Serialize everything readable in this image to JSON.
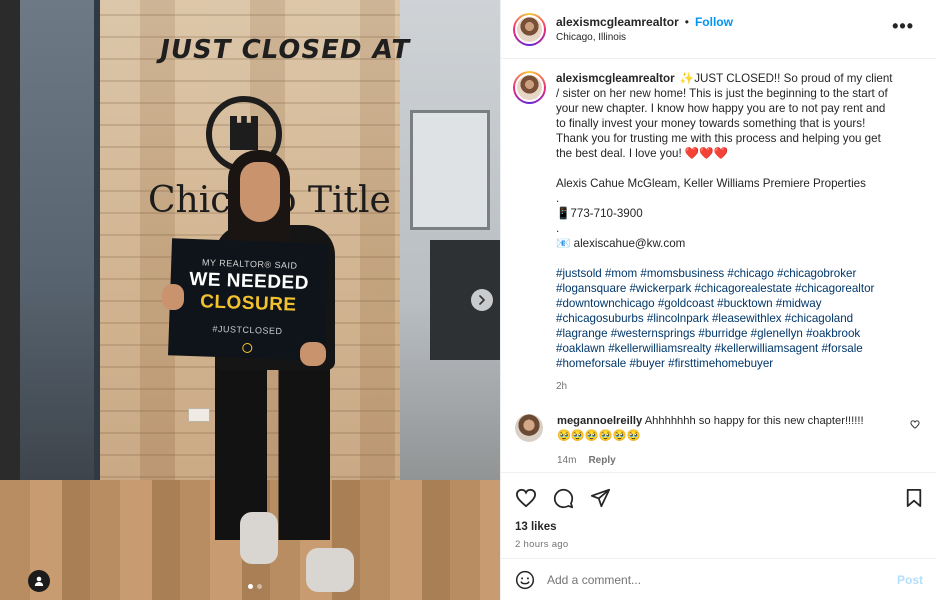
{
  "photo": {
    "sign_title": "JUST CLOSED AT",
    "company": "Chicago Title",
    "placard": {
      "line1": "MY REALTOR® SAID",
      "line2": "WE NEEDED",
      "line3": "CLOSURE",
      "line4": "#JUSTCLOSED"
    },
    "carousel_total": 2,
    "carousel_active": 1,
    "icons": {
      "next": "chevron-right-icon",
      "tag": "user-tag-icon"
    }
  },
  "header": {
    "username": "alexismcgleamrealtor",
    "separator": "•",
    "follow_label": "Follow",
    "location": "Chicago, Illinois",
    "more_label": "•••"
  },
  "caption": {
    "username": "alexismcgleamrealtor",
    "lines": [
      "✨JUST CLOSED!! So proud of my client / sister on her new home! This is just the beginning to the start of your new chapter. I know how happy you are to not pay rent and to finally invest your money towards something that is yours! Thank you for trusting me with this process and helping you get the best deal. I love you!",
      "❤️❤️❤️"
    ],
    "signature": "Alexis Cahue McGleam, Keller Williams Premiere Properties",
    "dot1": ".",
    "phone": "📱773-710-3900",
    "dot2": ".",
    "email": "📧 alexiscahue@kw.com",
    "hashtags": "#justsold #mom #momsbusiness #chicago #chicagobroker #logansquare #wickerpark #chicagorealestate #chicagorealtor #downtownchicago #goldcoast #bucktown #midway #chicagosuburbs #lincolnpark #leasewithlex #chicagoland #lagrange #westernsprings #burridge #glenellyn #oakbrook #oaklawn #kellerwilliamsrealty #kellerwilliamsagent #forsale #homeforsale #buyer #firsttimehomebuyer",
    "time": "2h"
  },
  "comment": {
    "username": "megannoelreilly",
    "text": "Ahhhhhhh so happy for this new chapter!!!!!! 🥹🥹🥹🥹🥹🥹",
    "time": "14m",
    "reply_label": "Reply"
  },
  "actions": {
    "likes": "13 likes",
    "posted": "2 hours ago"
  },
  "composer": {
    "placeholder": "Add a comment...",
    "post_label": "Post"
  },
  "colors": {
    "link": "#0095f6",
    "hashtag": "#00376b",
    "muted": "#737373",
    "heart": "#e0245e"
  }
}
